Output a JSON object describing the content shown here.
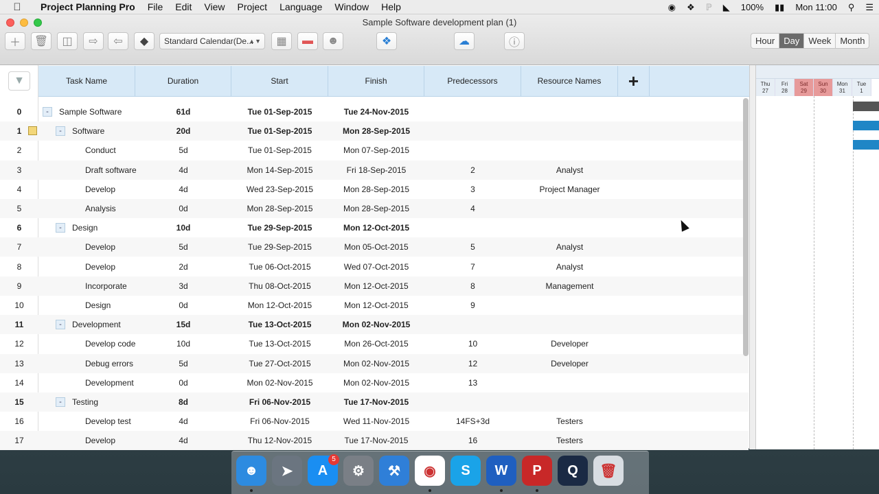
{
  "menubar": {
    "apple": "",
    "app": "Project Planning Pro",
    "items": [
      "File",
      "Edit",
      "View",
      "Project",
      "Language",
      "Window",
      "Help"
    ],
    "battery": "100%",
    "clock": "Mon 11:00"
  },
  "window": {
    "title": "Sample Software development plan (1)",
    "calendar_select": "Standard Calendar(De...",
    "scale_buttons": [
      "Hour",
      "Day",
      "Week",
      "Month"
    ],
    "active_scale": "Day"
  },
  "table": {
    "headers": [
      "Task Name",
      "Duration",
      "Start",
      "Finish",
      "Predecessors",
      "Resource Names"
    ],
    "add_column": "+",
    "rows": [
      {
        "num": "0",
        "name": "Sample Software",
        "duration": "61d",
        "start": "Tue 01-Sep-2015",
        "finish": "Tue 24-Nov-2015",
        "pred": "",
        "res": "",
        "level": 0,
        "summary": true
      },
      {
        "num": "1",
        "name": "Software",
        "duration": "20d",
        "start": "Tue 01-Sep-2015",
        "finish": "Mon 28-Sep-2015",
        "pred": "",
        "res": "",
        "level": 1,
        "summary": true,
        "note": true
      },
      {
        "num": "2",
        "name": "Conduct",
        "duration": "5d",
        "start": "Tue 01-Sep-2015",
        "finish": "Mon 07-Sep-2015",
        "pred": "",
        "res": "",
        "level": 2
      },
      {
        "num": "3",
        "name": "Draft software",
        "duration": "4d",
        "start": "Mon 14-Sep-2015",
        "finish": "Fri 18-Sep-2015",
        "pred": "2",
        "res": "Analyst",
        "level": 2
      },
      {
        "num": "4",
        "name": "Develop",
        "duration": "4d",
        "start": "Wed 23-Sep-2015",
        "finish": "Mon 28-Sep-2015",
        "pred": "3",
        "res": "Project Manager",
        "level": 2
      },
      {
        "num": "5",
        "name": "Analysis",
        "duration": "0d",
        "start": "Mon 28-Sep-2015",
        "finish": "Mon 28-Sep-2015",
        "pred": "4",
        "res": "",
        "level": 2
      },
      {
        "num": "6",
        "name": "Design",
        "duration": "10d",
        "start": "Tue 29-Sep-2015",
        "finish": "Mon 12-Oct-2015",
        "pred": "",
        "res": "",
        "level": 1,
        "summary": true
      },
      {
        "num": "7",
        "name": "Develop",
        "duration": "5d",
        "start": "Tue 29-Sep-2015",
        "finish": "Mon 05-Oct-2015",
        "pred": "5",
        "res": "Analyst",
        "level": 2
      },
      {
        "num": "8",
        "name": "Develop",
        "duration": "2d",
        "start": "Tue 06-Oct-2015",
        "finish": "Wed 07-Oct-2015",
        "pred": "7",
        "res": "Analyst",
        "level": 2
      },
      {
        "num": "9",
        "name": "Incorporate",
        "duration": "3d",
        "start": "Thu 08-Oct-2015",
        "finish": "Mon 12-Oct-2015",
        "pred": "8",
        "res": "Management",
        "level": 2
      },
      {
        "num": "10",
        "name": "Design",
        "duration": "0d",
        "start": "Mon 12-Oct-2015",
        "finish": "Mon 12-Oct-2015",
        "pred": "9",
        "res": "",
        "level": 2
      },
      {
        "num": "11",
        "name": "Development",
        "duration": "15d",
        "start": "Tue 13-Oct-2015",
        "finish": "Mon 02-Nov-2015",
        "pred": "",
        "res": "",
        "level": 1,
        "summary": true
      },
      {
        "num": "12",
        "name": "Develop code",
        "duration": "10d",
        "start": "Tue 13-Oct-2015",
        "finish": "Mon 26-Oct-2015",
        "pred": "10",
        "res": "Developer",
        "level": 2
      },
      {
        "num": "13",
        "name": "Debug errors",
        "duration": "5d",
        "start": "Tue 27-Oct-2015",
        "finish": "Mon 02-Nov-2015",
        "pred": "12",
        "res": "Developer",
        "level": 2
      },
      {
        "num": "14",
        "name": "Development",
        "duration": "0d",
        "start": "Mon 02-Nov-2015",
        "finish": "Mon 02-Nov-2015",
        "pred": "13",
        "res": "",
        "level": 2
      },
      {
        "num": "15",
        "name": "Testing",
        "duration": "8d",
        "start": "Fri 06-Nov-2015",
        "finish": "Tue 17-Nov-2015",
        "pred": "",
        "res": "",
        "level": 1,
        "summary": true
      },
      {
        "num": "16",
        "name": "Develop test",
        "duration": "4d",
        "start": "Fri 06-Nov-2015",
        "finish": "Wed 11-Nov-2015",
        "pred": "14FS+3d",
        "res": "Testers",
        "level": 2
      },
      {
        "num": "17",
        "name": "Develop",
        "duration": "4d",
        "start": "Thu 12-Nov-2015",
        "finish": "Tue 17-Nov-2015",
        "pred": "16",
        "res": "Testers",
        "level": 2
      }
    ]
  },
  "gantt": {
    "days": [
      {
        "d": "Thu",
        "n": "27",
        "weekend": false
      },
      {
        "d": "Fri",
        "n": "28",
        "weekend": false
      },
      {
        "d": "Sat",
        "n": "29",
        "weekend": true
      },
      {
        "d": "Sun",
        "n": "30",
        "weekend": true
      },
      {
        "d": "Mon",
        "n": "31",
        "weekend": false
      },
      {
        "d": "Tue",
        "n": "1",
        "weekend": false
      }
    ],
    "colors": {
      "summary": "#555555",
      "task": "#1f86c6",
      "weekend": "#e79a9a"
    }
  },
  "dock": {
    "apps": [
      "Finder",
      "Launchpad",
      "App Store",
      "System Preferences",
      "Xcode",
      "Chrome",
      "Skype",
      "WPS",
      "Project Planning Pro",
      "QuickTime",
      "Trash"
    ],
    "appstore_badge": "5"
  }
}
